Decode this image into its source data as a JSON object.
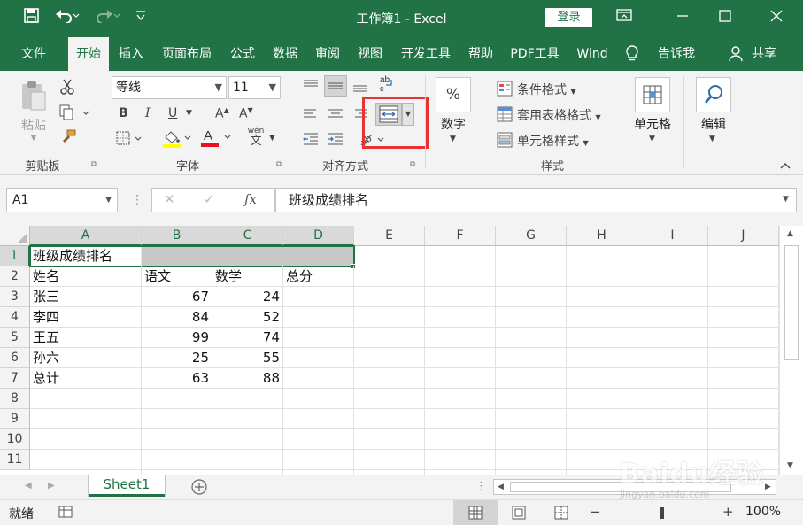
{
  "window": {
    "title": "工作簿1  -  Excel",
    "login": "登录"
  },
  "tabs": [
    "文件",
    "开始",
    "插入",
    "页面布局",
    "公式",
    "数据",
    "审阅",
    "视图",
    "开发工具",
    "帮助",
    "PDF工具",
    "Wind",
    "告诉我",
    "共享"
  ],
  "ribbon": {
    "clipboard": {
      "paste": "粘贴",
      "label": "剪贴板"
    },
    "font": {
      "name": "等线",
      "size": "11",
      "bold": "B",
      "italic": "I",
      "underline": "U",
      "grow": "A",
      "shrink": "A",
      "wen": "wén",
      "wen_char": "文",
      "label": "字体"
    },
    "alignment": {
      "label": "对齐方式"
    },
    "number": {
      "pct": "%",
      "label": "数字"
    },
    "styles": {
      "conditional": "条件格式",
      "table": "套用表格格式",
      "cell": "单元格样式",
      "label": "样式"
    },
    "cells": {
      "label": "单元格"
    },
    "editing": {
      "label": "编辑"
    }
  },
  "formula_bar": {
    "name_box": "A1",
    "fx": "fx",
    "content": "班级成绩排名"
  },
  "grid": {
    "columns": [
      "A",
      "B",
      "C",
      "D",
      "E",
      "F",
      "G",
      "H",
      "I",
      "J"
    ],
    "rows": [
      "1",
      "2",
      "3",
      "4",
      "5",
      "6",
      "7",
      "8",
      "9",
      "10",
      "11"
    ],
    "title": "班级成绩排名",
    "headers": [
      "姓名",
      "语文",
      "数学",
      "总分"
    ],
    "data": [
      [
        "张三",
        "67",
        "24"
      ],
      [
        "李四",
        "84",
        "52"
      ],
      [
        "王五",
        "99",
        "74"
      ],
      [
        "孙六",
        "25",
        "55"
      ],
      [
        "总计",
        "63",
        "88"
      ]
    ]
  },
  "sheet": {
    "name": "Sheet1"
  },
  "status": {
    "ready": "就绪",
    "zoom": "100%"
  },
  "watermark": {
    "text": "Baidu经验",
    "url": "jingyan.baidu.com"
  },
  "colors": {
    "brand": "#217346",
    "highlight": "#e8342e",
    "merged_fill": "#c8c8c8"
  }
}
